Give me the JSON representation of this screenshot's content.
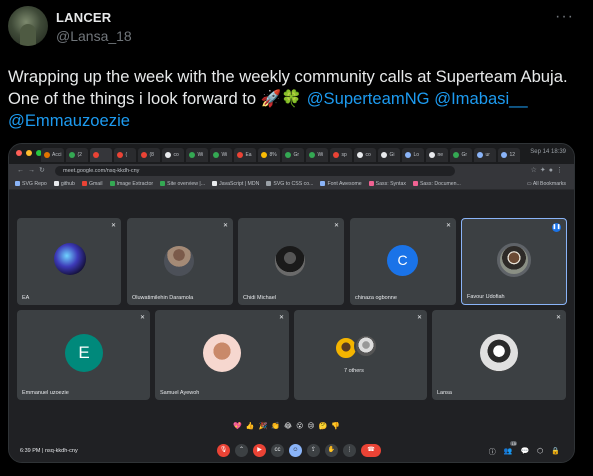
{
  "tweet": {
    "author_name": "LANCER",
    "author_handle": "@Lansa_18",
    "more_label": "···",
    "text_prefix": "Wrapping up the week with the weekly community calls at Superteam Abuja. One of the things i look forward to ",
    "emojis": "🚀🍀",
    "mentions": [
      "@SuperteamNG",
      "@Imabasi__",
      "@Emmauzoezie"
    ]
  },
  "browser": {
    "tabs": [
      {
        "label": "Acci",
        "color": "#e37400"
      },
      {
        "label": "(2",
        "color": "#34a853"
      },
      {
        "label": "",
        "color": "#ea4335",
        "active": true
      },
      {
        "label": "(",
        "color": "#ea4335"
      },
      {
        "label": "(8",
        "color": "#ea4335"
      },
      {
        "label": "co",
        "color": "#e8eaed"
      },
      {
        "label": "Wi",
        "color": "#34a853"
      },
      {
        "label": "Wi",
        "color": "#34a853"
      },
      {
        "label": "Ea",
        "color": "#ea4335"
      },
      {
        "label": "8%",
        "color": "#fbbc04"
      },
      {
        "label": "Gr",
        "color": "#34a853"
      },
      {
        "label": "Wi",
        "color": "#34a853"
      },
      {
        "label": "sp",
        "color": "#ea4335"
      },
      {
        "label": "co",
        "color": "#e8eaed"
      },
      {
        "label": "Gi",
        "color": "#e8eaed"
      },
      {
        "label": "Lo",
        "color": "#8ab4f8"
      },
      {
        "label": "ne",
        "color": "#e8eaed"
      },
      {
        "label": "Gr",
        "color": "#34a853"
      },
      {
        "label": "ur",
        "color": "#8ab4f8"
      },
      {
        "label": "12",
        "color": "#8ab4f8"
      }
    ],
    "clock": "Sep 14  18:39",
    "url": "meet.google.com/nsq-kkdh-cny",
    "bookmarks": [
      {
        "label": "SVG Repo",
        "color": "#8ab4f8"
      },
      {
        "label": "github",
        "color": "#e8eaed"
      },
      {
        "label": "Gmail",
        "color": "#ea4335"
      },
      {
        "label": "Image Extractor",
        "color": "#34a853"
      },
      {
        "label": "Site overview |...",
        "color": "#34a853"
      },
      {
        "label": "JavaScript | MDN",
        "color": "#e8eaed"
      },
      {
        "label": "SVG to CSS co...",
        "color": "#9aa0a6"
      },
      {
        "label": "Font Awesome",
        "color": "#8ab4f8"
      },
      {
        "label": "Sass: Syntax",
        "color": "#f06292"
      },
      {
        "label": "Sass: Documen...",
        "color": "#f06292"
      }
    ],
    "all_bookmarks": "All Bookmarks"
  },
  "meet": {
    "participants_row1": [
      {
        "name": "EA",
        "type": "photo",
        "photo": "galaxy"
      },
      {
        "name": "Oluwatimilehin Daramola",
        "type": "photo",
        "photo": "person"
      },
      {
        "name": "Chidi Michael",
        "type": "photo",
        "photo": "dark"
      },
      {
        "name": "chinaza ogbonne",
        "type": "letter",
        "letter": "C",
        "color": "#1a73e8"
      },
      {
        "name": "Favour Udofiah",
        "type": "photo",
        "photo": "smile",
        "speaking": true
      }
    ],
    "participants_row2": [
      {
        "name": "Emmanuel uzoezie",
        "type": "letter",
        "letter": "E",
        "color": "#00897b"
      },
      {
        "name": "Samuel Ayewoh",
        "type": "photo",
        "photo": "memoji"
      },
      {
        "name": "7 others",
        "type": "group"
      },
      {
        "name": "Lansa",
        "type": "photo",
        "photo": "sketch"
      }
    ],
    "reactions": [
      "💖",
      "👍",
      "🎉",
      "👏",
      "😂",
      "😮",
      "😢",
      "🤔",
      "👎"
    ],
    "time": "6:39 PM",
    "meeting_code": "nsq-kkdh-cny",
    "participant_count": "15",
    "accent": "#8ab4f8",
    "danger": "#ea4335"
  }
}
